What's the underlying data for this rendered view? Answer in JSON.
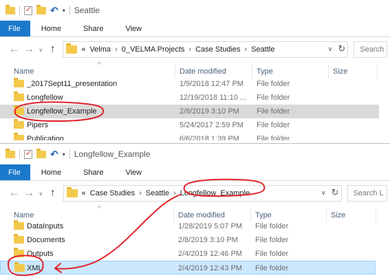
{
  "colors": {
    "file_tab": "#1979ca",
    "folder": "#f3c94c",
    "annotation": "#e0232a",
    "selected_gray": "#d9d9d9",
    "selected_blue": "#cce8ff"
  },
  "window1": {
    "title": "Seattle",
    "ribbon": {
      "file": "File",
      "home": "Home",
      "share": "Share",
      "view": "View"
    },
    "breadcrumb": [
      "«",
      "Velma",
      "0_VELMA Projects",
      "Case Studies",
      "Seattle"
    ],
    "search_placeholder": "Search S",
    "columns": {
      "name": "Name",
      "date": "Date modified",
      "type": "Type",
      "size": "Size"
    },
    "rows": [
      {
        "name": "_2017Sept11_presentation",
        "date": "1/9/2018 12:47 PM",
        "type": "File folder"
      },
      {
        "name": "Longfellow",
        "date": "12/19/2018 11:10 ...",
        "type": "File folder"
      },
      {
        "name": "Longfellow_Example",
        "date": "2/8/2019 3:10 PM",
        "type": "File folder"
      },
      {
        "name": "Pipers",
        "date": "5/24/2017 2:59 PM",
        "type": "File folder"
      },
      {
        "name": "Publication",
        "date": "6/6/2018 1:39 PM",
        "type": "File folder"
      }
    ]
  },
  "window2": {
    "title": "Longfellow_Example",
    "ribbon": {
      "file": "File",
      "home": "Home",
      "share": "Share",
      "view": "View"
    },
    "breadcrumb": [
      "«",
      "Case Studies",
      "Seattle",
      "Longfellow_Example"
    ],
    "search_placeholder": "Search L",
    "columns": {
      "name": "Name",
      "date": "Date modified",
      "type": "Type",
      "size": "Size"
    },
    "rows": [
      {
        "name": "DataInputs",
        "date": "1/28/2019 5:07 PM",
        "type": "File folder"
      },
      {
        "name": "Documents",
        "date": "2/8/2019 3:10 PM",
        "type": "File folder"
      },
      {
        "name": "Outputs",
        "date": "2/4/2019 12:46 PM",
        "type": "File folder"
      },
      {
        "name": "XML",
        "date": "2/4/2019 12:43 PM",
        "type": "File folder"
      }
    ]
  }
}
